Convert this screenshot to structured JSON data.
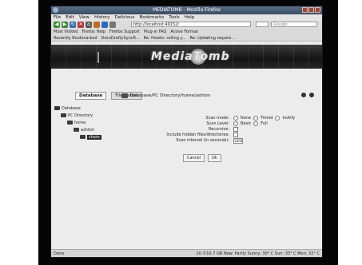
{
  "window": {
    "title": "MEDIATOMB - Mozilla Firefox"
  },
  "menu": [
    "File",
    "Edit",
    "View",
    "History",
    "Delicious",
    "Bookmarks",
    "Tools",
    "Help"
  ],
  "nav": {
    "url": "http://localhost:49152/",
    "search_placeholder": "Google"
  },
  "bookmarks": [
    "Most Visited",
    "Firefox Help",
    "Firefox Support",
    "Plug-in FAQ",
    "Active Format"
  ],
  "bookmarks2": [
    "Recently Bookmarked",
    "DocsDraftySyncR...",
    "Re: Howto: rolling y...",
    "Re: Updating require..."
  ],
  "banner": {
    "logo_text": "MediaTomb"
  },
  "tabs": {
    "database": "Database",
    "filesystem": "Filesystem"
  },
  "path": {
    "text": "Database/PC Directory/home/ashton"
  },
  "tree": [
    {
      "label": "Database",
      "depth": 0
    },
    {
      "label": "PC Directory",
      "depth": 1
    },
    {
      "label": "home",
      "depth": 2
    },
    {
      "label": "ashton",
      "depth": 3
    },
    {
      "label": "share",
      "depth": 4
    }
  ],
  "form": {
    "scan_mode_label": "Scan mode:",
    "scan_mode_opts": [
      "None",
      "Timed",
      "Inotify"
    ],
    "scan_level_label": "Scan Level:",
    "scan_level_opts": [
      "Basic",
      "Full"
    ],
    "recursive_label": "Recursive:",
    "hidden_label": "Include hidden files/directories:",
    "interval_label": "Scan interval (in seconds):",
    "interval_value": "1800",
    "cancel": "Cancel",
    "ok": "Ok"
  },
  "status": {
    "left": "Done",
    "right": "10.7/10.7 GB  New: Partly Sunny, 30° C  Sun: 33° C  Mon: 32° C"
  }
}
